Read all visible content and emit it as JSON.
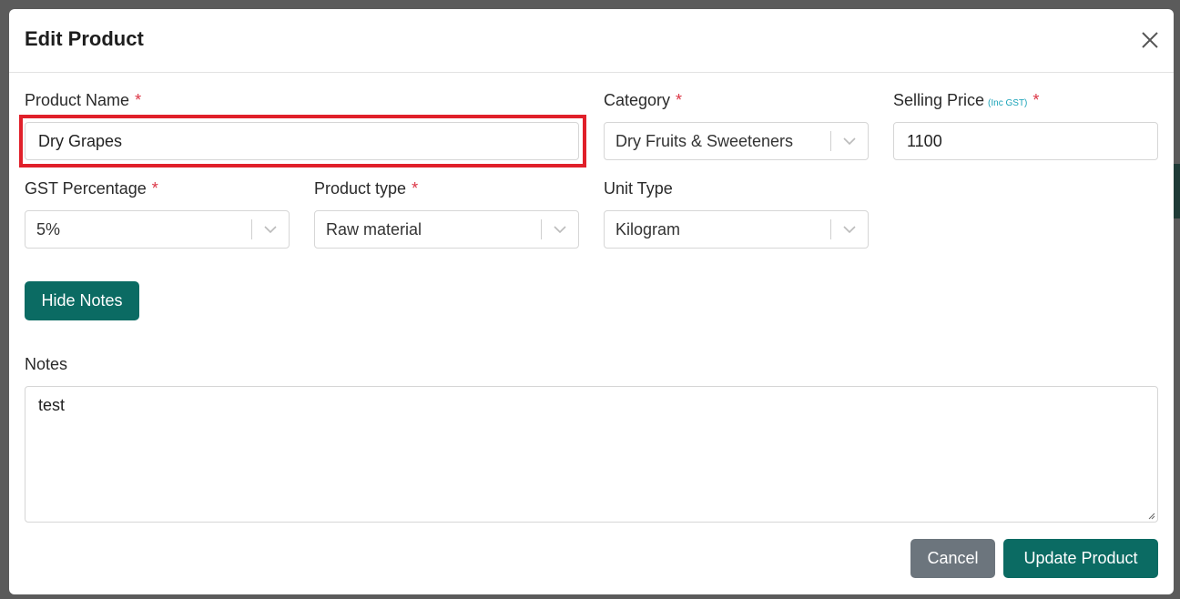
{
  "modal": {
    "title": "Edit Product"
  },
  "form": {
    "product_name": {
      "label": "Product Name",
      "required_mark": "*",
      "value": "Dry Grapes"
    },
    "category": {
      "label": "Category",
      "required_mark": "*",
      "selected": "Dry Fruits & Sweeteners"
    },
    "selling_price": {
      "label": "Selling Price",
      "note": "(Inc GST)",
      "required_mark": "*",
      "value": "1100"
    },
    "gst_percentage": {
      "label": "GST Percentage",
      "required_mark": "*",
      "selected": "5%"
    },
    "product_type": {
      "label": "Product type",
      "required_mark": "*",
      "selected": "Raw material"
    },
    "unit_type": {
      "label": "Unit Type",
      "selected": "Kilogram"
    },
    "hide_notes_label": "Hide Notes",
    "notes": {
      "label": "Notes",
      "value": "test"
    }
  },
  "footer": {
    "cancel_label": "Cancel",
    "update_label": "Update Product"
  },
  "colors": {
    "primary": "#0b6b63",
    "secondary": "#6c757d",
    "required": "#dc3545",
    "highlight": "#e0202a"
  }
}
